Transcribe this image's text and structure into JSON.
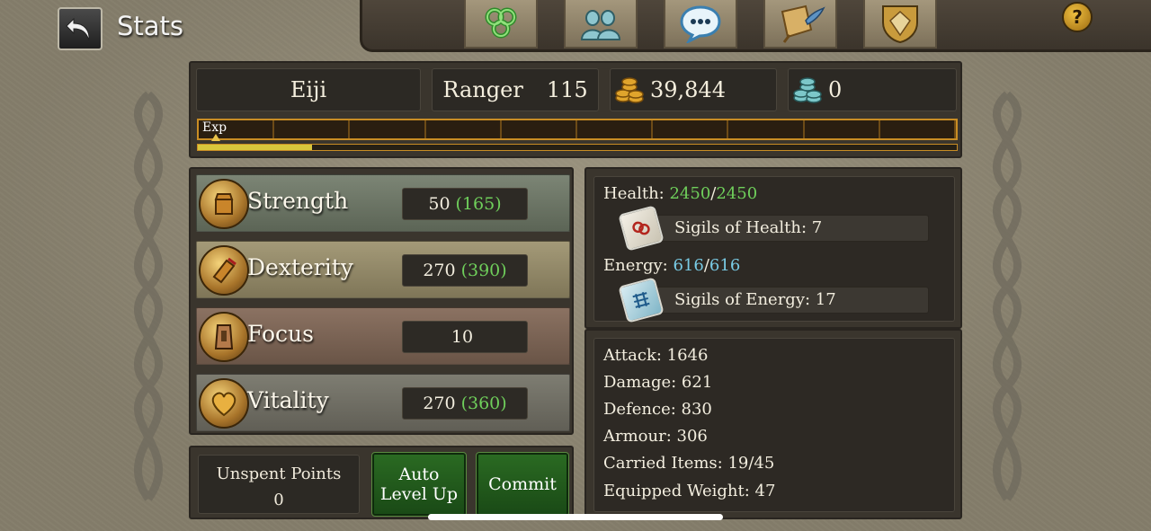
{
  "header": {
    "title": "Stats"
  },
  "top_tabs": [
    {
      "icon": "triskele-icon"
    },
    {
      "icon": "party-icon"
    },
    {
      "icon": "chat-icon"
    },
    {
      "icon": "quest-scroll-icon"
    },
    {
      "icon": "guild-crest-icon"
    }
  ],
  "help_label": "?",
  "character": {
    "name": "Eiji",
    "class": "Ranger",
    "level": "115",
    "gold": "39,844",
    "platinum": "0",
    "exp_label": "Exp",
    "exp_progress": 0.15
  },
  "attributes": [
    {
      "name": "Strength",
      "base": "50",
      "total": "(165)",
      "icon": "strength-icon"
    },
    {
      "name": "Dexterity",
      "base": "270",
      "total": "(390)",
      "icon": "dexterity-icon"
    },
    {
      "name": "Focus",
      "base": "10",
      "total": "",
      "icon": "focus-icon"
    },
    {
      "name": "Vitality",
      "base": "270",
      "total": "(360)",
      "icon": "vitality-icon"
    }
  ],
  "unspent": {
    "label": "Unspent Points",
    "value": "0"
  },
  "buttons": {
    "auto_line1": "Auto",
    "auto_line2": "Level Up",
    "commit": "Commit"
  },
  "vitals": {
    "health_label": "Health:",
    "health_current": "2450",
    "health_max": "2450",
    "sigils_health": "Sigils of Health: 7",
    "energy_label": "Energy:",
    "energy_current": "616",
    "energy_max": "616",
    "sigils_energy": "Sigils of Energy: 17",
    "slash": "/"
  },
  "combat": [
    "Attack: 1646",
    "Damage: 621",
    "Defence: 830",
    "Armour: 306",
    "Carried Items: 19/45",
    "Equipped Weight: 47"
  ],
  "colors": {
    "accent_green": "#6fcf5b",
    "accent_cyan": "#79cbe5",
    "exp_gold": "#d8c63c"
  }
}
